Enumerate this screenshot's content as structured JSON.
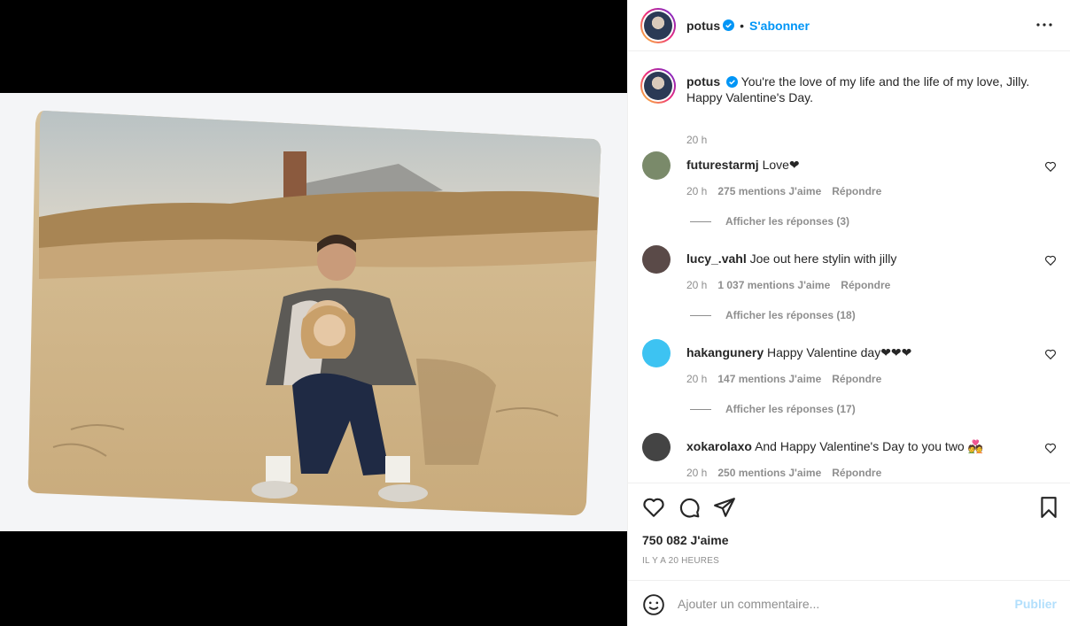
{
  "post": {
    "username": "potus",
    "follow_label": "S'abonner",
    "dot": "•",
    "caption": "You're the love of my life and the life of my love, Jilly. Happy Valentine's Day.",
    "caption_time": "20 h"
  },
  "comments": [
    {
      "username": "futurestarmj",
      "text": "Love❤",
      "time": "20 h",
      "likes": "275 mentions J'aime",
      "reply_label": "Répondre",
      "view_replies": "Afficher les réponses (3)",
      "avatar_color": "#7a8a6a"
    },
    {
      "username": "lucy_.vahl",
      "text": "Joe out here stylin with jilly",
      "time": "20 h",
      "likes": "1 037 mentions J'aime",
      "reply_label": "Répondre",
      "view_replies": "Afficher les réponses (18)",
      "avatar_color": "#5a4a48"
    },
    {
      "username": "hakangunery",
      "text": "Happy Valentine day❤❤❤",
      "time": "20 h",
      "likes": "147 mentions J'aime",
      "reply_label": "Répondre",
      "view_replies": "Afficher les réponses (17)",
      "avatar_color": "#3dc3f2"
    },
    {
      "username": "xokarolaxo",
      "text": "And Happy Valentine's Day to you two 💑",
      "time": "20 h",
      "likes": "250 mentions J'aime",
      "reply_label": "Répondre",
      "avatar_color": "#444444"
    }
  ],
  "actions": {
    "likes_count": "750 082 J'aime",
    "posted_ago": "IL Y A 20 HEURES"
  },
  "comment_box": {
    "placeholder": "Ajouter un commentaire...",
    "publish_label": "Publier"
  },
  "colors": {
    "accent": "#0095f6",
    "publish_disabled": "#b2dffc",
    "muted": "#8e8e8e"
  }
}
